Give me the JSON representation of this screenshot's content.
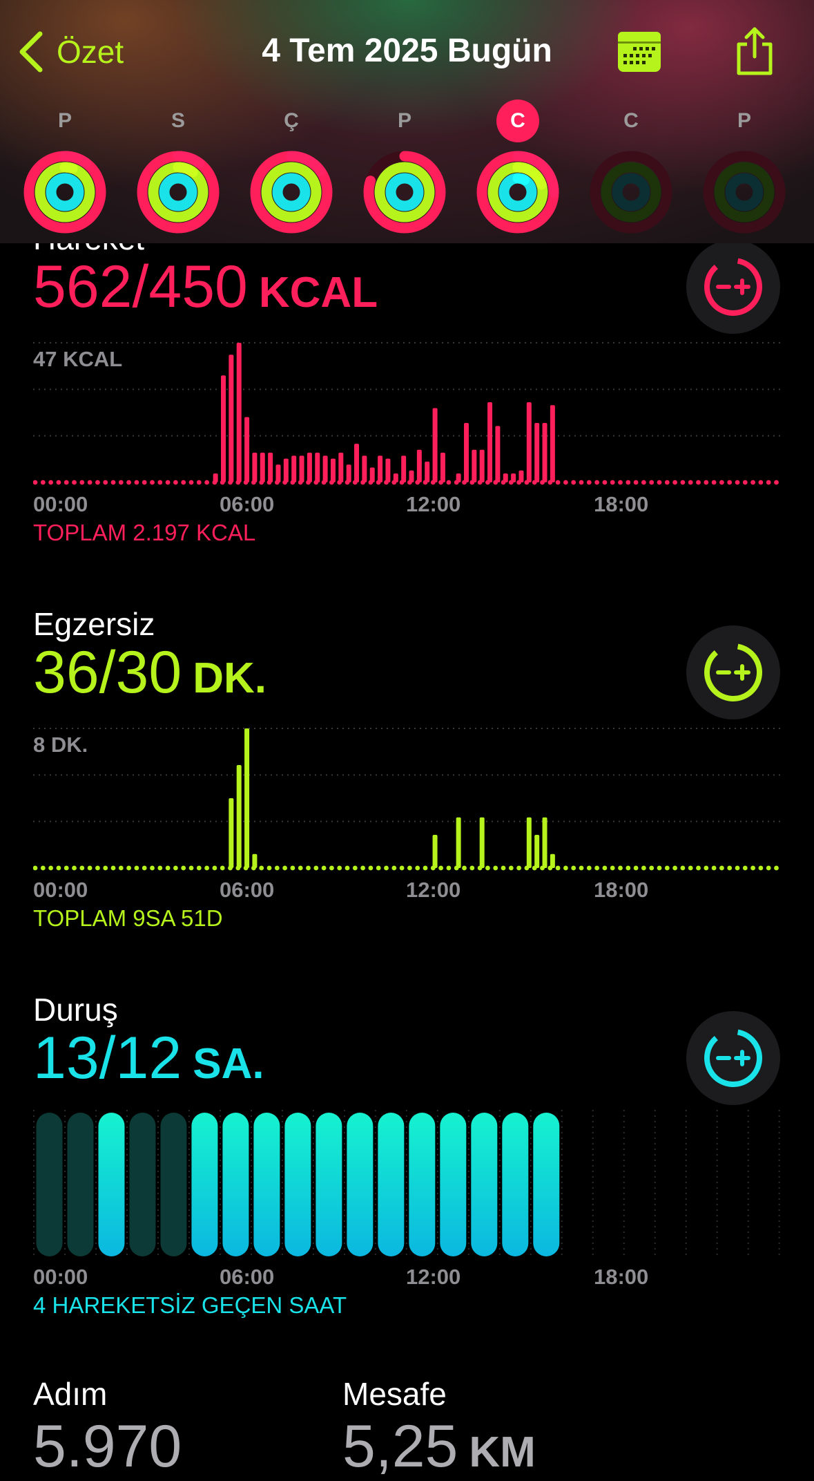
{
  "header": {
    "back_label": "Özet",
    "title": "4 Tem 2025 Bugün"
  },
  "week": {
    "days": [
      {
        "letter": "P",
        "move": 1.1,
        "exercise": 1.05,
        "stand": 1.0,
        "future": false,
        "today": false
      },
      {
        "letter": "S",
        "move": 1.1,
        "exercise": 1.1,
        "stand": 1.0,
        "future": false,
        "today": false
      },
      {
        "letter": "Ç",
        "move": 1.15,
        "exercise": 1.0,
        "stand": 1.0,
        "future": false,
        "today": false
      },
      {
        "letter": "P",
        "move": 0.8,
        "exercise": 1.0,
        "stand": 1.0,
        "future": false,
        "today": false
      },
      {
        "letter": "C",
        "move": 1.25,
        "exercise": 1.2,
        "stand": 1.08,
        "future": false,
        "today": true
      },
      {
        "letter": "C",
        "move": 0,
        "exercise": 0,
        "stand": 0,
        "future": true,
        "today": false
      },
      {
        "letter": "P",
        "move": 0,
        "exercise": 0,
        "stand": 0,
        "future": true,
        "today": false
      }
    ]
  },
  "colors": {
    "move": "#ff1f5a",
    "exercise": "#b6f21b",
    "stand": "#19e2e8",
    "move_dim": "#3b0d18",
    "exercise_dim": "#1d330a",
    "stand_dim": "#0b2f33",
    "tick": "#8e8e93"
  },
  "move": {
    "label": "Hareket",
    "value": "562/450",
    "unit": "KCAL",
    "max_label": "47 KCAL",
    "total": "TOPLAM 2.197 KCAL",
    "ticks": [
      "00:00",
      "06:00",
      "12:00",
      "18:00"
    ]
  },
  "exercise": {
    "label": "Egzersiz",
    "value": "36/30",
    "unit": "DK.",
    "max_label": "8 DK.",
    "total": "TOPLAM 9SA 51D",
    "ticks": [
      "00:00",
      "06:00",
      "12:00",
      "18:00"
    ]
  },
  "stand": {
    "label": "Duruş",
    "value": "13/12",
    "unit": "SA.",
    "total": "4 HAREKETSİZ GEÇEN SAAT",
    "ticks": [
      "00:00",
      "06:00",
      "12:00",
      "18:00"
    ]
  },
  "steps": {
    "label": "Adım",
    "value": "5.970"
  },
  "distance": {
    "label": "Mesafe",
    "value": "5,25",
    "unit": "KM"
  },
  "chart_data": [
    {
      "type": "bar",
      "name": "move",
      "ylim": [
        0,
        47
      ],
      "x_range_hours": [
        0,
        24
      ],
      "bars": [
        {
          "h": 5.75,
          "v": 3
        },
        {
          "h": 6.0,
          "v": 36
        },
        {
          "h": 6.25,
          "v": 43
        },
        {
          "h": 6.5,
          "v": 47
        },
        {
          "h": 6.75,
          "v": 22
        },
        {
          "h": 7.0,
          "v": 10
        },
        {
          "h": 7.25,
          "v": 10
        },
        {
          "h": 7.5,
          "v": 10
        },
        {
          "h": 7.75,
          "v": 6
        },
        {
          "h": 8.0,
          "v": 8
        },
        {
          "h": 8.25,
          "v": 9
        },
        {
          "h": 8.5,
          "v": 9
        },
        {
          "h": 8.75,
          "v": 10
        },
        {
          "h": 9.0,
          "v": 10
        },
        {
          "h": 9.25,
          "v": 9
        },
        {
          "h": 9.5,
          "v": 8
        },
        {
          "h": 9.75,
          "v": 10
        },
        {
          "h": 10.0,
          "v": 6
        },
        {
          "h": 10.25,
          "v": 13
        },
        {
          "h": 10.5,
          "v": 9
        },
        {
          "h": 10.75,
          "v": 5
        },
        {
          "h": 11.0,
          "v": 9
        },
        {
          "h": 11.25,
          "v": 8
        },
        {
          "h": 11.5,
          "v": 3
        },
        {
          "h": 11.75,
          "v": 9
        },
        {
          "h": 12.0,
          "v": 4
        },
        {
          "h": 12.25,
          "v": 11
        },
        {
          "h": 12.5,
          "v": 7
        },
        {
          "h": 12.75,
          "v": 25
        },
        {
          "h": 13.0,
          "v": 10
        },
        {
          "h": 13.5,
          "v": 3
        },
        {
          "h": 13.75,
          "v": 20
        },
        {
          "h": 14.0,
          "v": 11
        },
        {
          "h": 14.25,
          "v": 11
        },
        {
          "h": 14.5,
          "v": 27
        },
        {
          "h": 14.75,
          "v": 19
        },
        {
          "h": 15.0,
          "v": 3
        },
        {
          "h": 15.25,
          "v": 3
        },
        {
          "h": 15.5,
          "v": 4
        },
        {
          "h": 15.75,
          "v": 27
        },
        {
          "h": 16.0,
          "v": 20
        },
        {
          "h": 16.25,
          "v": 20
        },
        {
          "h": 16.5,
          "v": 26
        }
      ]
    },
    {
      "type": "bar",
      "name": "exercise",
      "ylim": [
        0,
        8
      ],
      "x_range_hours": [
        0,
        24
      ],
      "bars": [
        {
          "h": 6.25,
          "v": 4.0
        },
        {
          "h": 6.5,
          "v": 5.9
        },
        {
          "h": 6.75,
          "v": 8.0
        },
        {
          "h": 7.0,
          "v": 0.8
        },
        {
          "h": 12.75,
          "v": 1.9
        },
        {
          "h": 13.5,
          "v": 2.9
        },
        {
          "h": 14.25,
          "v": 2.9
        },
        {
          "h": 15.75,
          "v": 2.9
        },
        {
          "h": 16.0,
          "v": 1.9
        },
        {
          "h": 16.25,
          "v": 2.9
        },
        {
          "h": 16.5,
          "v": 0.8
        }
      ]
    },
    {
      "type": "bar",
      "name": "stand",
      "x_range_hours": [
        0,
        24
      ],
      "hours": [
        {
          "h": 0,
          "stood": false
        },
        {
          "h": 1,
          "stood": false
        },
        {
          "h": 2,
          "stood": true
        },
        {
          "h": 3,
          "stood": false
        },
        {
          "h": 4,
          "stood": false
        },
        {
          "h": 5,
          "stood": true
        },
        {
          "h": 6,
          "stood": true
        },
        {
          "h": 7,
          "stood": true
        },
        {
          "h": 8,
          "stood": true
        },
        {
          "h": 9,
          "stood": true
        },
        {
          "h": 10,
          "stood": true
        },
        {
          "h": 11,
          "stood": true
        },
        {
          "h": 12,
          "stood": true
        },
        {
          "h": 13,
          "stood": true
        },
        {
          "h": 14,
          "stood": true
        },
        {
          "h": 15,
          "stood": true
        },
        {
          "h": 16,
          "stood": true
        }
      ]
    }
  ]
}
